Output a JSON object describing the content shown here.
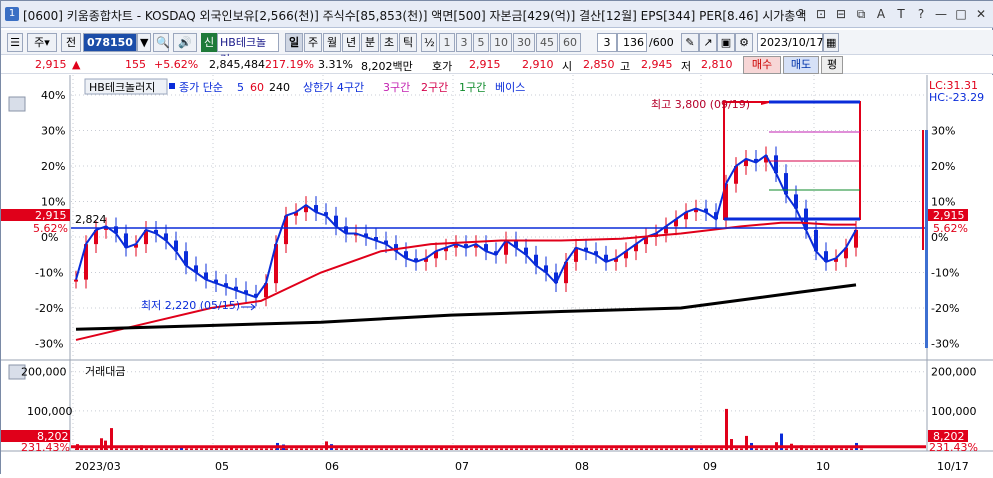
{
  "window": {
    "title": "[0600] 키움종합차트 - KOSDAQ 외국인보유[2,566(천)] 주식수[85,853(천)] 액면[500] 자본금[429(억)] 결산[12월] EPS[344] PER[8.46] 시가총액",
    "app_num": "1",
    "controls": [
      "?",
      "⊡",
      "⊟",
      "⧉",
      "A",
      "T",
      "?",
      "—",
      "□",
      "✕"
    ]
  },
  "toolbar": {
    "menu_char": "주",
    "range_char": "전",
    "code": "078150",
    "dropdown_arrow": "▼",
    "search_icon": "🔍",
    "sound_icon": "🔊",
    "shin_label": "신",
    "stock_name": "HB테크놀러",
    "periods": [
      "일",
      "주",
      "월",
      "년",
      "분",
      "초",
      "틱"
    ],
    "active_period": "일",
    "fraction": "½",
    "intervals": [
      "1",
      "3",
      "5",
      "10",
      "30",
      "45",
      "60"
    ],
    "interval_select": "3",
    "count": "136",
    "count_total": "/600",
    "date": "2023/10/17"
  },
  "quote": {
    "price": "2,915",
    "arrow": "▲",
    "change": "155",
    "change_pct": "+5.62%",
    "volume": "2,845,484",
    "vol_ratio": "217.19%",
    "turnover": "3.31%",
    "amount": "8,202백만",
    "hoga_label": "호가",
    "hoga_val": "2,915",
    "hoga2": "2,910",
    "open_label": "시",
    "open": "2,850",
    "high_label": "고",
    "high": "2,945",
    "low_label": "저",
    "low": "2,810",
    "buy": "매수",
    "sell": "매도",
    "eval": "평"
  },
  "legend": {
    "name": "HB테크놀러지",
    "close": "종가 단순",
    "ma5": "5",
    "ma60": "60",
    "ma240": "240",
    "zone_upper": "상한가 4구간",
    "zone3": "3구간",
    "zone2": "2구간",
    "zone1": "1구간",
    "base": "베이스"
  },
  "right_info": {
    "lc": "LC:31.31",
    "hc": "HC:-23.29"
  },
  "annotations": {
    "high": "최고 3,800 (09/19)",
    "low": "최저 2,220 (05/15)",
    "level_label": "2,824",
    "price_tag": "2,915",
    "pct_tag": "5.62%"
  },
  "axis": {
    "left_pct": [
      "40%",
      "30%",
      "20%",
      "10%",
      "0%",
      "-10%",
      "-20%",
      "-30%"
    ],
    "right_pct": [
      "30%",
      "20%",
      "10%",
      "0%",
      "-10%",
      "-20%",
      "-30%"
    ],
    "months": [
      "2023/03",
      "05",
      "06",
      "07",
      "08",
      "09",
      "10",
      "10/17"
    ]
  },
  "volume_panel": {
    "title": "거래대금",
    "ticks": [
      "200,000",
      "100,000"
    ],
    "value_tag": "8,202",
    "pct_tag": "231.43%"
  },
  "colors": {
    "up": "#e0001a",
    "down": "#0a2cd9",
    "ma5": "#0a2cd9",
    "ma60": "#e0001a",
    "ma240": "#000000",
    "zone3": "#c21fb0",
    "zone2": "#d4004a",
    "zone1": "#0d8a2a"
  }
}
